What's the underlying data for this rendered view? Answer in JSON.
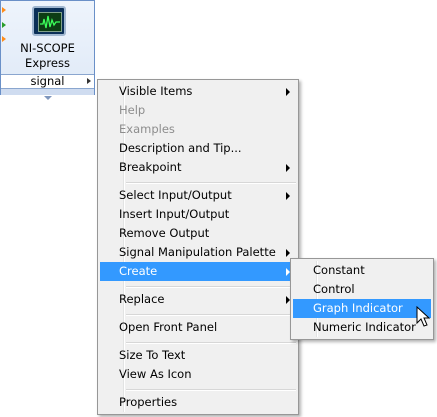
{
  "node": {
    "title_line1": "NI-SCOPE",
    "title_line2": "Express",
    "terminal_label": "signal",
    "icon": "oscilloscope-icon"
  },
  "context_menu": {
    "items": [
      {
        "label": "Visible Items",
        "submenu": true,
        "enabled": true
      },
      {
        "label": "Help",
        "submenu": false,
        "enabled": false
      },
      {
        "label": "Examples",
        "submenu": false,
        "enabled": false
      },
      {
        "label": "Description and Tip...",
        "submenu": false,
        "enabled": true
      },
      {
        "label": "Breakpoint",
        "submenu": true,
        "enabled": true
      },
      {
        "label": "Select Input/Output",
        "submenu": true,
        "enabled": true
      },
      {
        "label": "Insert Input/Output",
        "submenu": false,
        "enabled": true
      },
      {
        "label": "Remove Output",
        "submenu": false,
        "enabled": true
      },
      {
        "label": "Signal Manipulation Palette",
        "submenu": true,
        "enabled": true
      },
      {
        "label": "Create",
        "submenu": true,
        "enabled": true,
        "highlighted": true
      },
      {
        "label": "Replace",
        "submenu": true,
        "enabled": true
      },
      {
        "label": "Open Front Panel",
        "submenu": false,
        "enabled": true
      },
      {
        "label": "Size To Text",
        "submenu": false,
        "enabled": true
      },
      {
        "label": "View As Icon",
        "submenu": false,
        "enabled": true
      },
      {
        "label": "Properties",
        "submenu": false,
        "enabled": true
      }
    ]
  },
  "create_submenu": {
    "items": [
      {
        "label": "Constant"
      },
      {
        "label": "Control"
      },
      {
        "label": "Graph Indicator",
        "highlighted": true
      },
      {
        "label": "Numeric Indicator"
      }
    ]
  },
  "colors": {
    "highlight": "#3399ff",
    "menu_bg": "#f0f0f0",
    "disabled_text": "#8d8d8d",
    "node_border": "#6a90c8"
  }
}
